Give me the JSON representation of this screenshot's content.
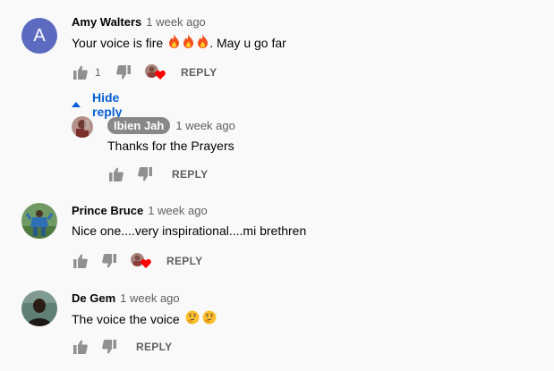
{
  "comments": [
    {
      "author": "Amy Walters",
      "time": "1 week ago",
      "avatar_letter": "A",
      "text": "Your voice is fire",
      "text_after": ". May u go far",
      "likes": "1",
      "reply": "REPLY",
      "hide_replies": "Hide reply",
      "replies": [
        {
          "author": "Ibien Jah",
          "time": "1 week ago",
          "text": "Thanks for the Prayers",
          "reply": "REPLY"
        }
      ]
    },
    {
      "author": "Prince Bruce",
      "time": "1 week ago",
      "text": "Nice one....very inspirational....mi brethren",
      "reply": "REPLY"
    },
    {
      "author": "De Gem",
      "time": "1 week ago",
      "text": "The voice the voice",
      "reply": "REPLY"
    }
  ],
  "colors": {
    "background": "#f9f9f9",
    "link_blue": "#065fd4",
    "icon_gray": "#909090",
    "heart_red": "#ff0000",
    "avatar_purple": "#5c6bc0",
    "pill_gray": "#888888"
  }
}
